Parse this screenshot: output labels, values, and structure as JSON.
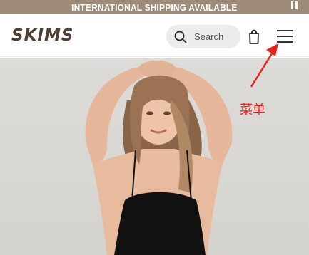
{
  "promo": {
    "text": "INTERNATIONAL SHIPPING AVAILABLE"
  },
  "header": {
    "logo_text": "SKIMS",
    "search_label": "Search"
  },
  "annotation": {
    "label": "菜单"
  },
  "colors": {
    "promo_bg": "#9e8a79",
    "logo": "#4f3e33",
    "search_bg": "#ececec",
    "annotation": "#e8231a"
  },
  "icons": {
    "pause": "pause-icon",
    "search": "search-icon",
    "bag": "shopping-bag-icon",
    "menu": "hamburger-menu-icon"
  }
}
